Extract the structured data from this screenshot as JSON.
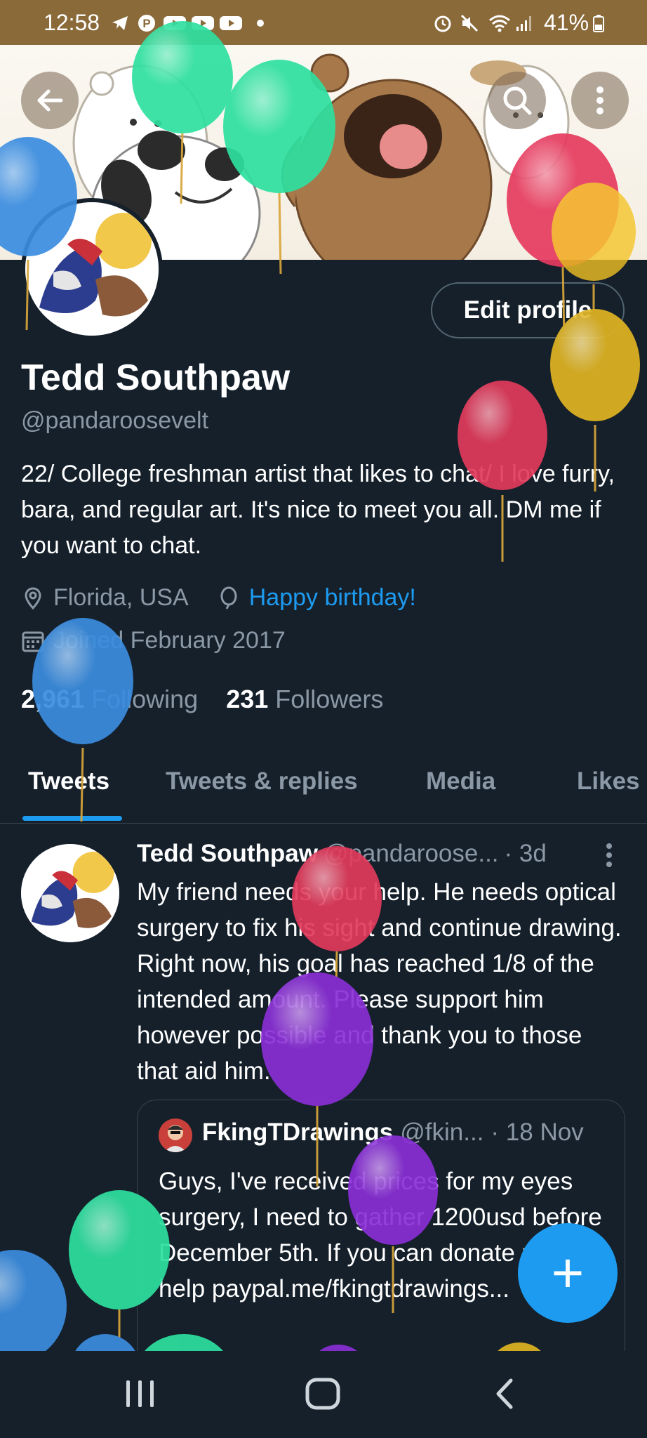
{
  "status_bar": {
    "time": "12:58",
    "battery": "41%",
    "icons": [
      "telegram-icon",
      "pinterest-icon",
      "youtube-icon",
      "youtube-icon",
      "youtube-icon",
      "dot-icon",
      "alarm-icon",
      "mute-icon",
      "wifi-icon",
      "signal-icon",
      "battery-icon"
    ]
  },
  "header": {
    "back_icon": "arrow-left-icon",
    "search_icon": "search-icon",
    "more_icon": "more-vertical-icon"
  },
  "profile": {
    "edit_label": "Edit profile",
    "name": "Tedd Southpaw",
    "handle": "@pandaroosevelt",
    "bio": "22/ College freshman artist that likes to chat/ I love furry, bara, and regular art. It's nice to meet you all. DM me if you want to chat.",
    "location": "Florida, USA",
    "birthday": "Happy birthday!",
    "joined": "Joined February 2017",
    "following_count": "2,961",
    "following_label": "Following",
    "followers_count": "231",
    "followers_label": "Followers"
  },
  "tabs": [
    {
      "label": "Tweets",
      "active": true
    },
    {
      "label": "Tweets & replies",
      "active": false
    },
    {
      "label": "Media",
      "active": false
    },
    {
      "label": "Likes",
      "active": false
    }
  ],
  "tweet": {
    "name": "Tedd Southpaw",
    "handle": "@pandaroose...",
    "time": "· 3d",
    "text": "My friend needs your help. He needs optical surgery to fix his sight and continue drawing. Right now, his goal has reached 1/8 of the intended amount. Please support him however possible and thank you to those that aid him.",
    "quote": {
      "name": "FkingTDrawings",
      "handle": "@fkin...",
      "time": "· 18 Nov",
      "text": "Guys, I've received prices for my eyes surgery, I need to gather 1200usd before December 5th. If you can donate please help paypal.me/fkingtdrawings..."
    }
  },
  "fab_label": "+",
  "colors": {
    "background": "#15202b",
    "accent": "#1d9bf0",
    "muted": "#8b98a5",
    "status_bar": "#8b6a3a"
  }
}
